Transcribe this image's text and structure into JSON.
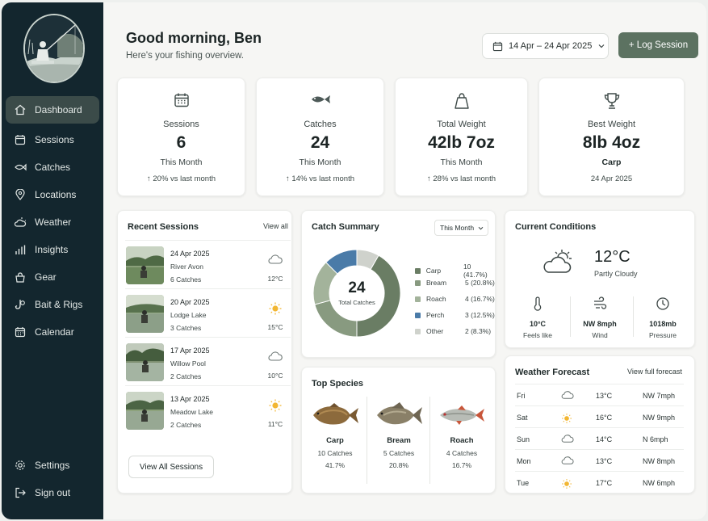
{
  "sidebar": {
    "items": [
      {
        "label": "Dashboard",
        "icon": "home-icon",
        "active": true
      },
      {
        "label": "Sessions",
        "icon": "calendar-icon"
      },
      {
        "label": "Catches",
        "icon": "fish-icon"
      },
      {
        "label": "Locations",
        "icon": "map-pin-icon"
      },
      {
        "label": "Weather",
        "icon": "weather-icon"
      },
      {
        "label": "Insights",
        "icon": "bar-chart-icon"
      },
      {
        "label": "Gear",
        "icon": "gear-bag-icon"
      },
      {
        "label": "Bait & Rigs",
        "icon": "bait-icon"
      },
      {
        "label": "Calendar",
        "icon": "calendar-grid-icon"
      }
    ],
    "bottom": [
      {
        "label": "Settings",
        "icon": "gear-icon"
      },
      {
        "label": "Sign out",
        "icon": "sign-out-icon"
      }
    ]
  },
  "header": {
    "greeting": "Good morning, Ben",
    "subtitle": "Here's your fishing overview.",
    "date_range": "14 Apr – 24 Apr 2025",
    "log_button": "+ Log Session"
  },
  "stats": [
    {
      "label": "Sessions",
      "value": "6",
      "period": "This Month",
      "change": "↑ 20% vs last month",
      "icon": "calendar-icon"
    },
    {
      "label": "Catches",
      "value": "24",
      "period": "This Month",
      "change": "↑ 14% vs last month",
      "icon": "fish-icon"
    },
    {
      "label": "Total Weight",
      "value": "42lb 7oz",
      "period": "This Month",
      "change": "↑ 28% vs last month",
      "icon": "weight-icon"
    },
    {
      "label": "Best Weight",
      "value": "8lb 4oz",
      "period": "Carp",
      "change": "24 Apr 2025",
      "icon": "trophy-icon"
    }
  ],
  "recent_sessions": {
    "title": "Recent Sessions",
    "view_all": "View all",
    "button": "View All Sessions",
    "rows": [
      {
        "date": "24 Apr 2025",
        "location": "River Avon",
        "catches": "6 Catches",
        "weather": "cloud-icon",
        "temp": "12°C"
      },
      {
        "date": "20 Apr 2025",
        "location": "Lodge Lake",
        "catches": "3 Catches",
        "weather": "sun-icon",
        "temp": "15°C"
      },
      {
        "date": "17 Apr 2025",
        "location": "Willow Pool",
        "catches": "2 Catches",
        "weather": "cloud-icon",
        "temp": "10°C"
      },
      {
        "date": "13 Apr 2025",
        "location": "Meadow Lake",
        "catches": "2 Catches",
        "weather": "sun-icon",
        "temp": "11°C"
      }
    ]
  },
  "catch_summary": {
    "title": "Catch Summary",
    "period": "This Month",
    "total": "24",
    "total_label": "Total Catches"
  },
  "chart_data": {
    "type": "pie",
    "categories": [
      "Carp",
      "Bream",
      "Roach",
      "Perch",
      "Other"
    ],
    "values": [
      10,
      5,
      4,
      3,
      2
    ],
    "labels": [
      "10 (41.7%)",
      "5 (20.8%)",
      "4 (16.7%)",
      "3 (12.5%)",
      "2 (8.3%)"
    ],
    "colors": [
      "#6a7d64",
      "#889a80",
      "#a3b39b",
      "#4a7ba8",
      "#cfd2cc"
    ]
  },
  "top_species": {
    "title": "Top Species",
    "items": [
      {
        "name": "Carp",
        "catches": "10 Catches",
        "pct": "41.7%"
      },
      {
        "name": "Bream",
        "catches": "5 Catches",
        "pct": "20.8%"
      },
      {
        "name": "Roach",
        "catches": "4 Catches",
        "pct": "16.7%"
      }
    ]
  },
  "conditions": {
    "title": "Current Conditions",
    "temp": "12°C",
    "desc": "Partly Cloudy",
    "items": [
      {
        "value": "10°C",
        "label": "Feels like",
        "icon": "thermometer-icon"
      },
      {
        "value": "NW 8mph",
        "label": "Wind",
        "icon": "wind-icon"
      },
      {
        "value": "1018mb",
        "label": "Pressure",
        "icon": "gauge-icon"
      }
    ]
  },
  "forecast": {
    "title": "Weather Forecast",
    "link": "View full forecast",
    "rows": [
      {
        "day": "Fri",
        "icon": "cloud-icon",
        "temp": "13°C",
        "wind": "NW 7mph"
      },
      {
        "day": "Sat",
        "icon": "sun-icon",
        "temp": "16°C",
        "wind": "NW 9mph"
      },
      {
        "day": "Sun",
        "icon": "cloud-icon",
        "temp": "14°C",
        "wind": "N 6mph"
      },
      {
        "day": "Mon",
        "icon": "cloud-icon",
        "temp": "13°C",
        "wind": "NW 8mph"
      },
      {
        "day": "Tue",
        "icon": "sun-icon",
        "temp": "17°C",
        "wind": "NW 6mph"
      }
    ]
  },
  "colors": {
    "sidebar": "#13262e",
    "accent": "#5c7261",
    "active_nav": "#3b4b49"
  }
}
